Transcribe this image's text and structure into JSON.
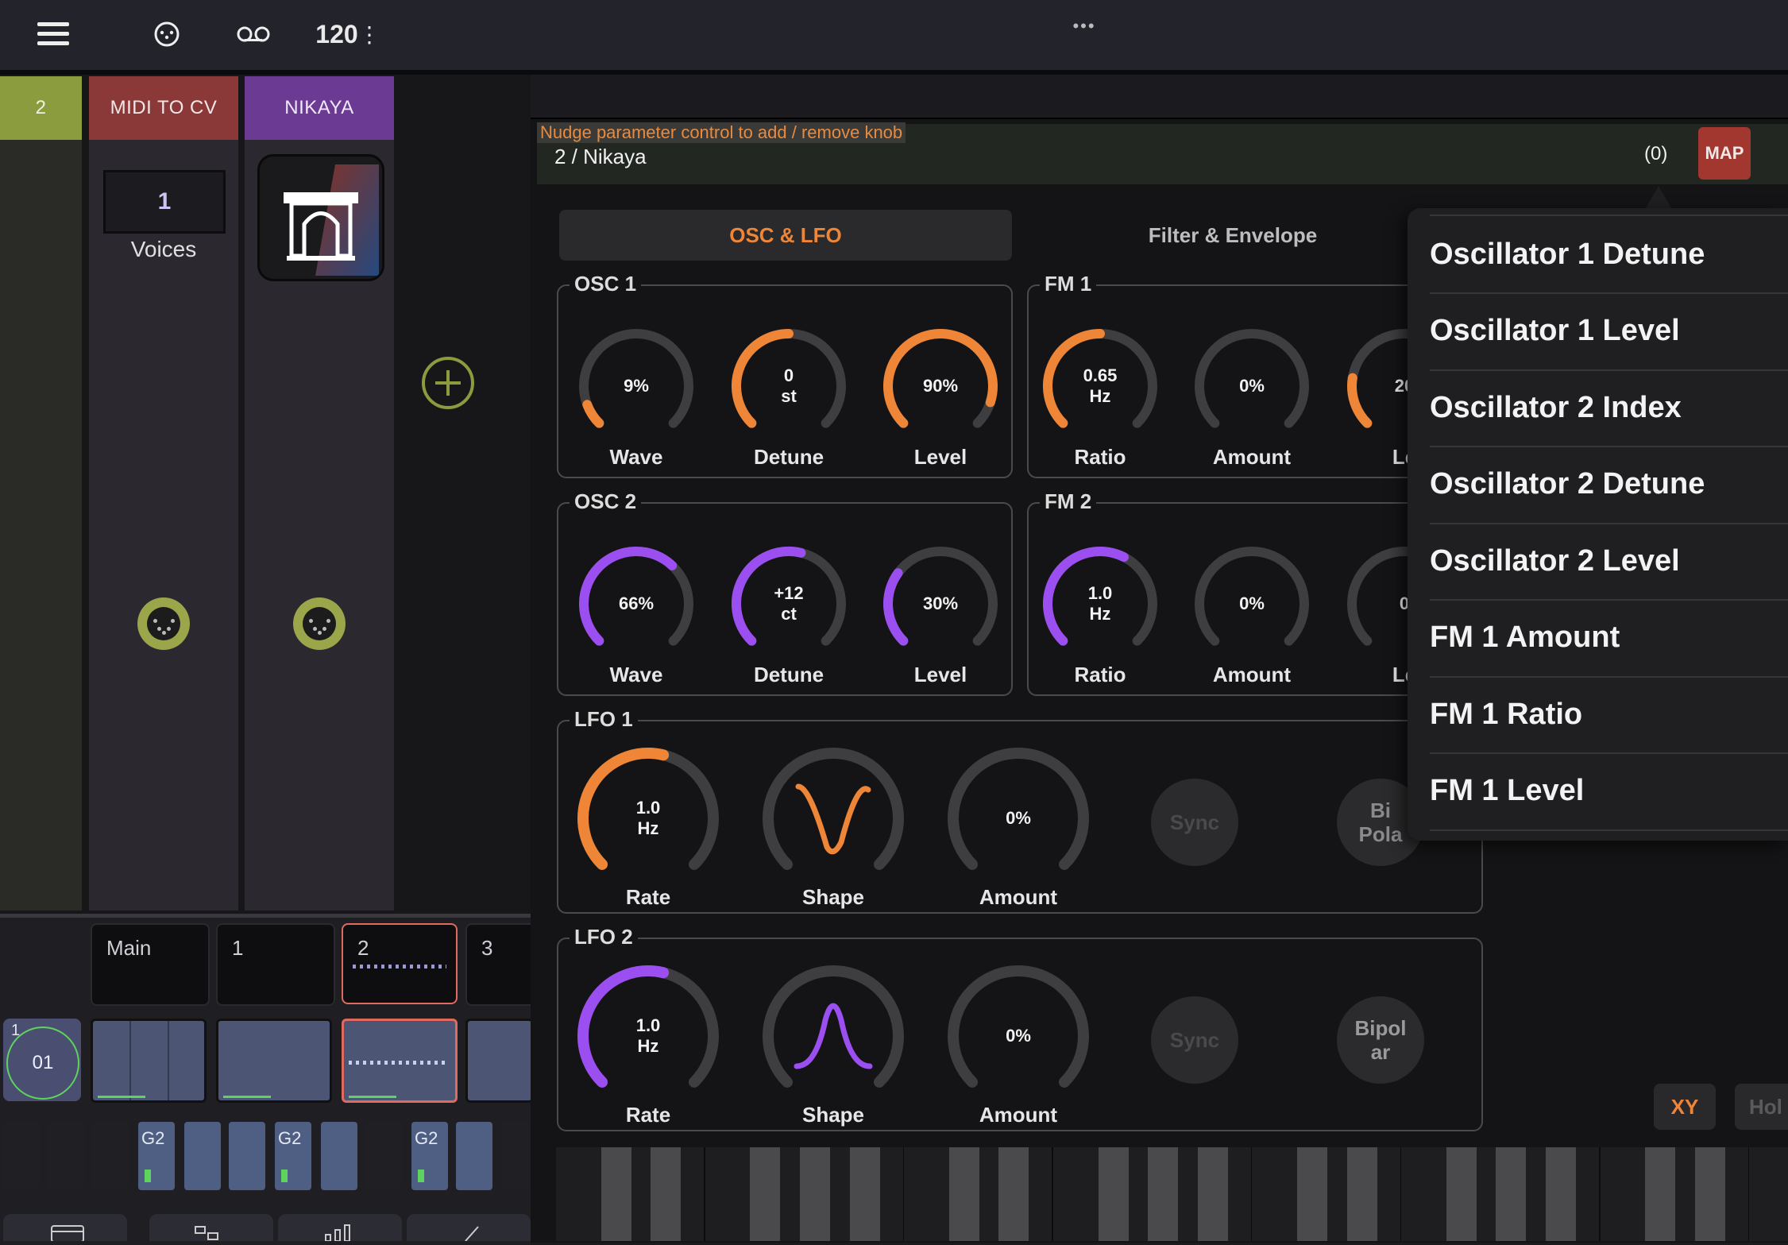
{
  "topbar": {
    "tempo": "120",
    "tempo_menu_glyph": "⋮",
    "more_glyph": "•••"
  },
  "tracks": [
    {
      "name": "2",
      "color": "#8a9c3e"
    },
    {
      "name": "MIDI TO CV",
      "color": "#8a3838",
      "voices_value": "1",
      "voices_label": "Voices"
    },
    {
      "name": "NIKAYA",
      "color": "#6b3a93"
    }
  ],
  "scenes": {
    "labels": [
      "Main",
      "1",
      "2",
      "3"
    ],
    "counter_small": "1",
    "counter_big": "01",
    "note_labels": [
      "G2",
      "G2",
      "G2"
    ]
  },
  "panel": {
    "hint": "Nudge parameter control to add / remove knob",
    "title": "2 / Nikaya",
    "mapped_count": "(0)",
    "map_button": "MAP",
    "tabs": [
      "OSC & LFO",
      "Filter & Envelope"
    ],
    "active_tab": "OSC & LFO",
    "colors": {
      "orange": "#ef8537",
      "purple": "#9b4ff0",
      "track_gray": "#3e3e40"
    },
    "sections": {
      "osc1": {
        "title": "OSC 1",
        "knobs": [
          {
            "label": "Wave",
            "line1": "9%",
            "line2": "",
            "level": 0.09,
            "color": "orange"
          },
          {
            "label": "Detune",
            "line1": "0",
            "line2": "st",
            "level": 0.5,
            "color": "orange"
          },
          {
            "label": "Level",
            "line1": "90%",
            "line2": "",
            "level": 0.9,
            "color": "orange"
          }
        ]
      },
      "fm1": {
        "title": "FM 1",
        "knobs": [
          {
            "label": "Ratio",
            "line1": "0.65",
            "line2": "Hz",
            "level": 0.5,
            "color": "orange"
          },
          {
            "label": "Amount",
            "line1": "0%",
            "line2": "",
            "level": 0.0,
            "color": "orange"
          },
          {
            "label": "Le",
            "line1": "20",
            "line2": "",
            "level": 0.2,
            "color": "orange"
          }
        ]
      },
      "osc2": {
        "title": "OSC 2",
        "knobs": [
          {
            "label": "Wave",
            "line1": "66%",
            "line2": "",
            "level": 0.66,
            "color": "purple"
          },
          {
            "label": "Detune",
            "line1": "+12",
            "line2": "ct",
            "level": 0.55,
            "color": "purple"
          },
          {
            "label": "Level",
            "line1": "30%",
            "line2": "",
            "level": 0.3,
            "color": "purple"
          }
        ]
      },
      "fm2": {
        "title": "FM 2",
        "knobs": [
          {
            "label": "Ratio",
            "line1": "1.0",
            "line2": "Hz",
            "level": 0.6,
            "color": "purple"
          },
          {
            "label": "Amount",
            "line1": "0%",
            "line2": "",
            "level": 0.0,
            "color": "purple"
          },
          {
            "label": "Le",
            "line1": "0",
            "line2": "",
            "level": 0.0,
            "color": "purple"
          }
        ]
      },
      "lfo1": {
        "title": "LFO 1",
        "rate": {
          "label": "Rate",
          "line1": "1.0",
          "line2": "Hz",
          "level": 0.55,
          "color": "orange"
        },
        "shape": {
          "label": "Shape",
          "shape": "v-wave",
          "color": "orange"
        },
        "amount": {
          "label": "Amount",
          "line1": "0%",
          "line2": "",
          "level": 0.0,
          "color": "orange"
        },
        "sync": "Sync",
        "bipolar_l1": "Bi",
        "bipolar_l2": "Pola"
      },
      "lfo2": {
        "title": "LFO 2",
        "rate": {
          "label": "Rate",
          "line1": "1.0",
          "line2": "Hz",
          "level": 0.55,
          "color": "purple"
        },
        "shape": {
          "label": "Shape",
          "shape": "bell",
          "color": "purple"
        },
        "amount": {
          "label": "Amount",
          "line1": "0%",
          "line2": "",
          "level": 0.0,
          "color": "purple"
        },
        "sync": "Sync",
        "bipolar_l1": "Bipol",
        "bipolar_l2": "ar"
      }
    },
    "xy_button": "XY",
    "hold_button": "Hol"
  },
  "dropdown": {
    "items": [
      "Oscillator 1 Detune",
      "Oscillator 1 Level",
      "Oscillator 2 Index",
      "Oscillator 2 Detune",
      "Oscillator 2 Level",
      "FM 1 Amount",
      "FM 1 Ratio",
      "FM 1 Level"
    ]
  }
}
